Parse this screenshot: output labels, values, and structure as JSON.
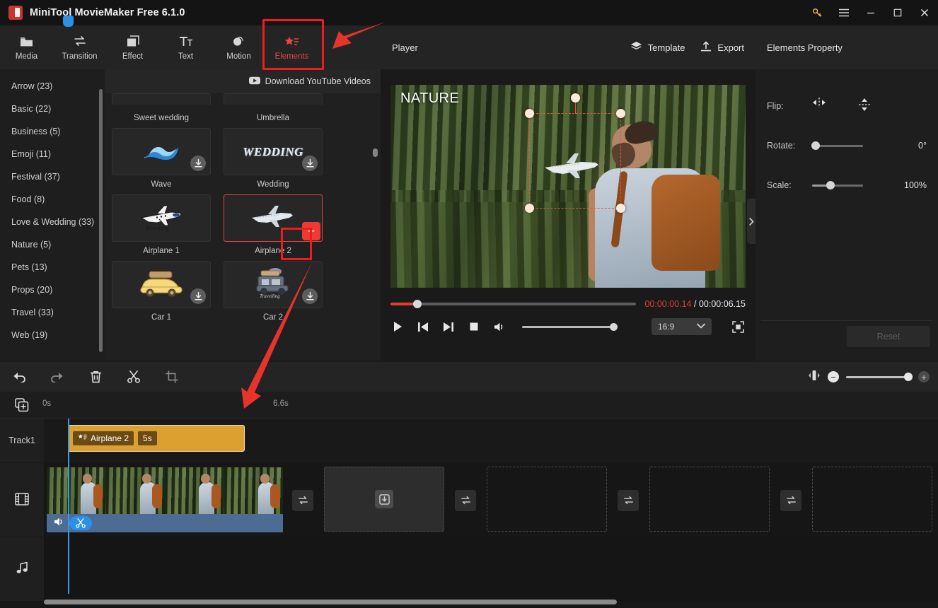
{
  "window": {
    "title": "MiniTool MovieMaker Free 6.1.0",
    "logo_icon": "app-logo-icon",
    "controls": [
      {
        "name": "key-icon",
        "glyph": "key"
      },
      {
        "name": "menu-icon",
        "glyph": "hamburger"
      },
      {
        "name": "minimize-icon",
        "glyph": "minimize"
      },
      {
        "name": "maximize-icon",
        "glyph": "maximize"
      },
      {
        "name": "close-icon",
        "glyph": "close"
      }
    ]
  },
  "toolbar": {
    "items": [
      {
        "label": "Media",
        "icon": "folder-icon",
        "active": false
      },
      {
        "label": "Transition",
        "icon": "transition-arrows-icon",
        "active": false
      },
      {
        "label": "Effect",
        "icon": "layers-square-icon",
        "active": false
      },
      {
        "label": "Text",
        "icon": "text-tt-icon",
        "active": false
      },
      {
        "label": "Motion",
        "icon": "motion-circle-icon",
        "active": false
      },
      {
        "label": "Elements",
        "icon": "elements-star-list-icon",
        "active": true
      }
    ]
  },
  "categories": [
    {
      "label": "Arrow (23)"
    },
    {
      "label": "Basic (22)"
    },
    {
      "label": "Business (5)"
    },
    {
      "label": "Emoji (11)"
    },
    {
      "label": "Festival (37)"
    },
    {
      "label": "Food (8)"
    },
    {
      "label": "Love & Wedding (33)"
    },
    {
      "label": "Nature (5)"
    },
    {
      "label": "Pets (13)"
    },
    {
      "label": "Props (20)"
    },
    {
      "label": "Travel (33)"
    },
    {
      "label": "Web (19)"
    }
  ],
  "elements_panel": {
    "download_youtube_label": "Download YouTube Videos",
    "download_youtube_icon": "youtube-icon",
    "partial_row_captions": [
      "Sweet wedding",
      "Umbrella"
    ],
    "rows": [
      [
        {
          "caption": "Wave",
          "icon": "wave-icon",
          "downloadable": true,
          "selected": false
        },
        {
          "caption": "Wedding",
          "icon": "wedding-text-icon",
          "downloadable": true,
          "selected": false
        }
      ],
      [
        {
          "caption": "Airplane 1",
          "icon": "airplane-travelling-icon",
          "downloadable": false,
          "selected": false
        },
        {
          "caption": "Airplane 2",
          "icon": "airplane-icon",
          "downloadable": false,
          "selected": true
        }
      ],
      [
        {
          "caption": "Car 1",
          "icon": "yellow-car-icon",
          "downloadable": true,
          "selected": false
        },
        {
          "caption": "Car 2",
          "icon": "grey-car-icon",
          "downloadable": true,
          "selected": false
        }
      ]
    ],
    "add_button_label": "+",
    "add_button_name": "add-element-button"
  },
  "player": {
    "header_title": "Player",
    "template_label": "Template",
    "template_icon": "layers-icon",
    "export_label": "Export",
    "export_icon": "upload-icon",
    "overlay_text": "NATURE",
    "current_time": "00:00:00.14",
    "time_separator": "/",
    "total_time": "00:00:06.15",
    "aspect_ratio": "16:9",
    "controls": [
      {
        "name": "play-button",
        "icon": "play-icon"
      },
      {
        "name": "previous-frame-button",
        "icon": "prev-frame-icon"
      },
      {
        "name": "next-frame-button",
        "icon": "next-frame-icon"
      },
      {
        "name": "stop-button",
        "icon": "stop-icon"
      },
      {
        "name": "volume-button",
        "icon": "volume-icon"
      }
    ],
    "fullscreen_icon": "fullscreen-icon",
    "collapse_icon": "chevron-right-icon",
    "selection": {
      "handles": 4,
      "rotation_handle": true,
      "element": "airplane-icon"
    }
  },
  "properties": {
    "title": "Elements Property",
    "flip_label": "Flip:",
    "flip_horizontal_icon": "flip-horizontal-icon",
    "flip_vertical_icon": "flip-vertical-icon",
    "rotate_label": "Rotate:",
    "rotate_value": "0°",
    "scale_label": "Scale:",
    "scale_value": "100%",
    "reset_label": "Reset"
  },
  "timeline": {
    "tools": [
      {
        "name": "undo-button",
        "icon": "undo-icon",
        "dim": false
      },
      {
        "name": "redo-button",
        "icon": "redo-icon",
        "dim": true
      },
      {
        "name": "delete-button",
        "icon": "trash-icon",
        "dim": false
      },
      {
        "name": "split-button",
        "icon": "scissors-icon",
        "dim": false
      },
      {
        "name": "crop-button",
        "icon": "crop-icon",
        "dim": true
      }
    ],
    "fit_icon": "fit-timeline-icon",
    "zoom_out_label": "−",
    "zoom_in_label": "+",
    "add_track_icon": "add-track-icon",
    "ruler_ticks": [
      "0s",
      "6.6s"
    ],
    "tracks": [
      {
        "label": "Track1",
        "icon": null
      },
      {
        "label": "",
        "icon": "film-icon"
      },
      {
        "label": "",
        "icon": "music-note-icon"
      }
    ],
    "element_clip": {
      "name": "Airplane 2",
      "duration": "5s",
      "icon": "elements-star-list-icon"
    },
    "video_clip": {
      "volume_icon": "volume-icon",
      "split_icon": "scissors-icon"
    },
    "transition_icon": "transition-arrows-icon",
    "placeholder_icon": "download-box-icon"
  },
  "annotations": {
    "highlight_color": "#ee1c1c",
    "arrow_color": "#e8332a"
  }
}
